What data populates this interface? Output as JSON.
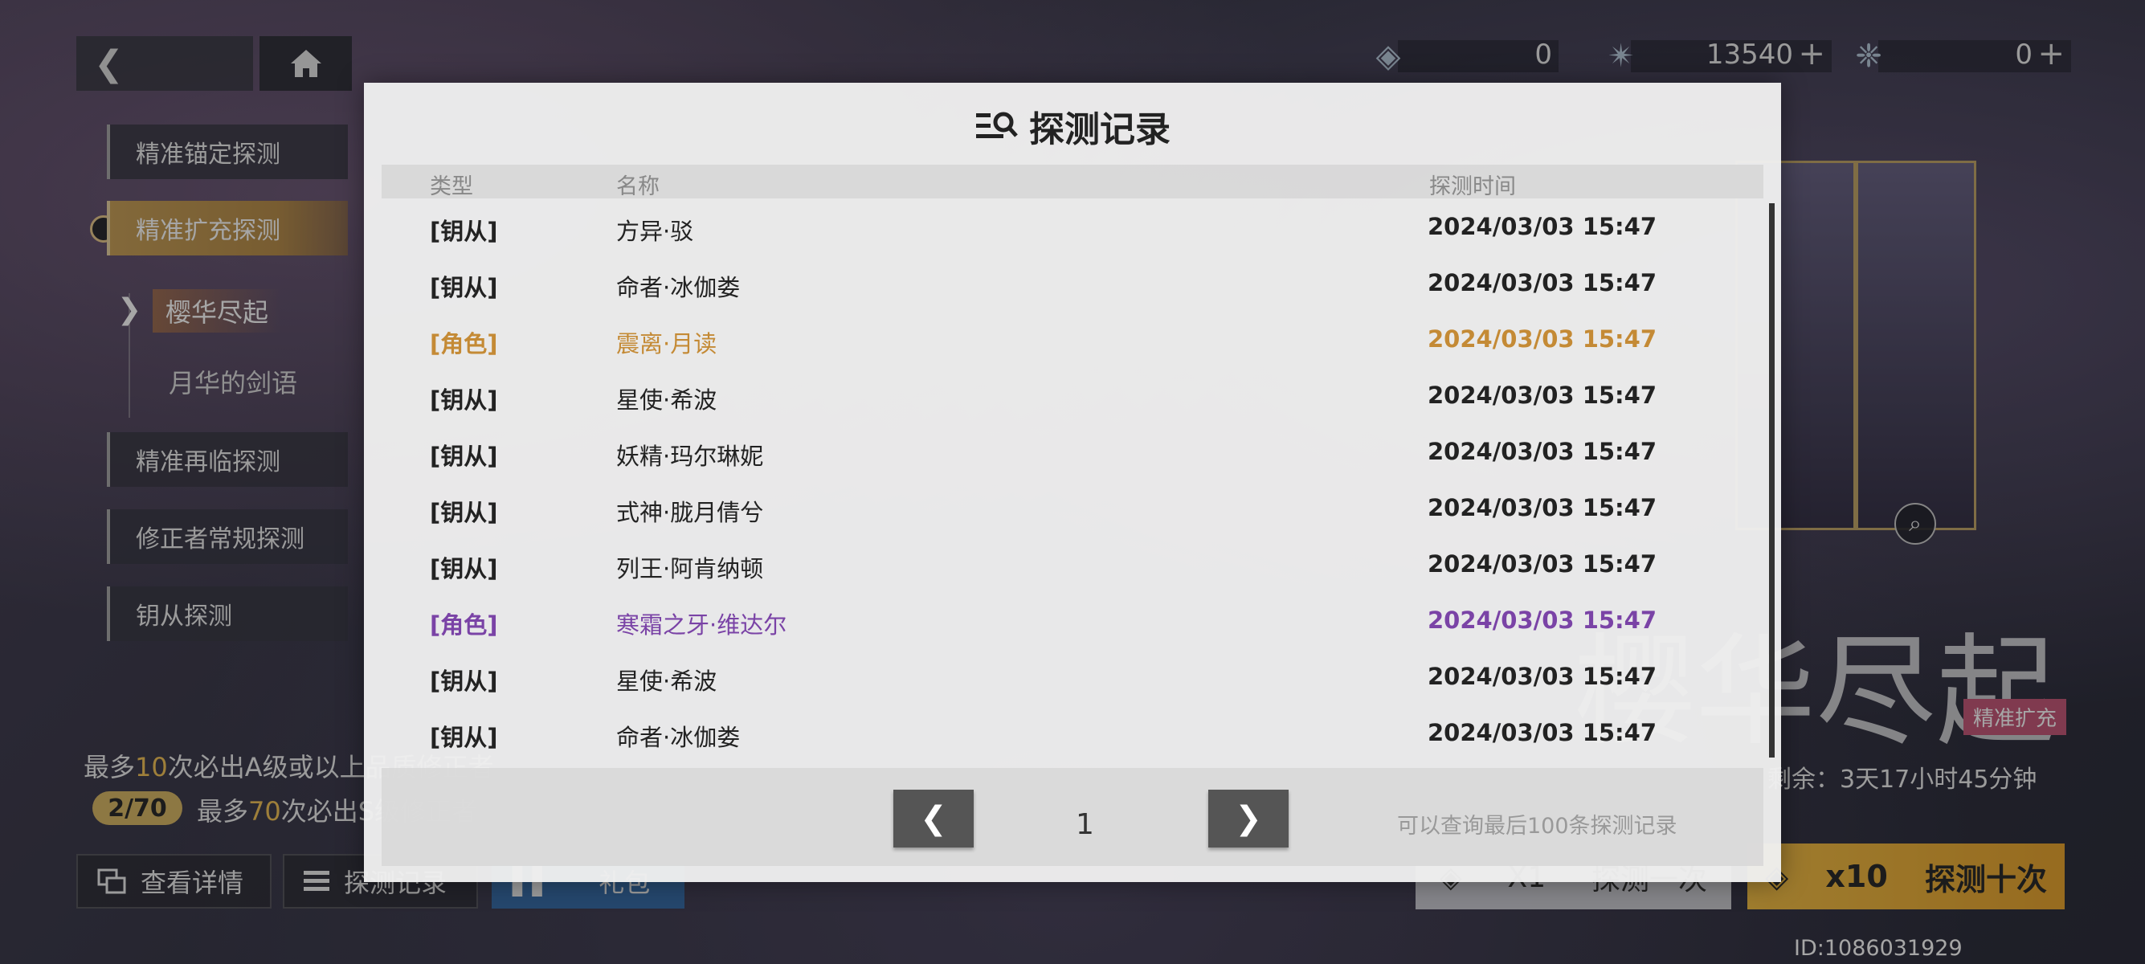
{
  "topbar": {
    "back_icon": "chevron-left-icon",
    "home_icon": "home-icon",
    "currencies": [
      {
        "icon": "ticket-icon",
        "value": "0",
        "has_plus": false
      },
      {
        "icon": "crystal-icon",
        "value": "13540",
        "has_plus": true
      },
      {
        "icon": "gem-icon",
        "value": "0",
        "has_plus": true
      }
    ]
  },
  "sidebar": {
    "items": [
      {
        "label": "精准锚定探测"
      },
      {
        "label": "精准扩充探测"
      },
      {
        "label": "精准再临探测"
      },
      {
        "label": "修正者常规探测"
      },
      {
        "label": "钥从探测"
      }
    ],
    "sub_items": [
      {
        "label": "樱华尽起"
      },
      {
        "label": "月华的剑语"
      }
    ]
  },
  "guarantee": {
    "line1_prefix": "最多",
    "line1_num": "10",
    "line1_suffix": "次必出A级或以上品质修正者",
    "pity": "2/70",
    "line2_prefix": "最多",
    "line2_num": "70",
    "line2_suffix": "次必出S级修正者"
  },
  "bottom_buttons": {
    "details": "查看详情",
    "records": "探测记录",
    "gift": "礼包"
  },
  "banner": {
    "title": "樱华尽起",
    "tag": "精准扩充",
    "timer": "剩余：3天17小时45分钟",
    "draw_one_count": "X1",
    "draw_one_label": "探测一次",
    "draw_ten_count": "x10",
    "draw_ten_label": "探测十次",
    "user_id": "ID:1086031929"
  },
  "modal": {
    "title": "探测记录",
    "headers": {
      "type": "类型",
      "name": "名称",
      "time": "探测时间"
    },
    "rows": [
      {
        "type": "[钥从]",
        "name": "方异·驳",
        "time": "2024/03/03 15:47",
        "rarity": "normal"
      },
      {
        "type": "[钥从]",
        "name": "命者·冰伽娄",
        "time": "2024/03/03 15:47",
        "rarity": "normal"
      },
      {
        "type": "[角色]",
        "name": "震离·月读",
        "time": "2024/03/03 15:47",
        "rarity": "gold"
      },
      {
        "type": "[钥从]",
        "name": "星使·希波",
        "time": "2024/03/03 15:47",
        "rarity": "normal"
      },
      {
        "type": "[钥从]",
        "name": "妖精·玛尔琳妮",
        "time": "2024/03/03 15:47",
        "rarity": "normal"
      },
      {
        "type": "[钥从]",
        "name": "式神·胧月倩兮",
        "time": "2024/03/03 15:47",
        "rarity": "normal"
      },
      {
        "type": "[钥从]",
        "name": "列王·阿肯纳顿",
        "time": "2024/03/03 15:47",
        "rarity": "normal"
      },
      {
        "type": "[角色]",
        "name": "寒霜之牙·维达尔",
        "time": "2024/03/03 15:47",
        "rarity": "purple"
      },
      {
        "type": "[钥从]",
        "name": "星使·希波",
        "time": "2024/03/03 15:47",
        "rarity": "normal"
      },
      {
        "type": "[钥从]",
        "name": "命者·冰伽娄",
        "time": "2024/03/03 15:47",
        "rarity": "normal"
      }
    ],
    "page": "1",
    "prev_glyph": "❮",
    "next_glyph": "❯",
    "note": "可以查询最后100条探测记录",
    "colors": {
      "gold": "#c48a35",
      "purple": "#7a43a6"
    }
  }
}
